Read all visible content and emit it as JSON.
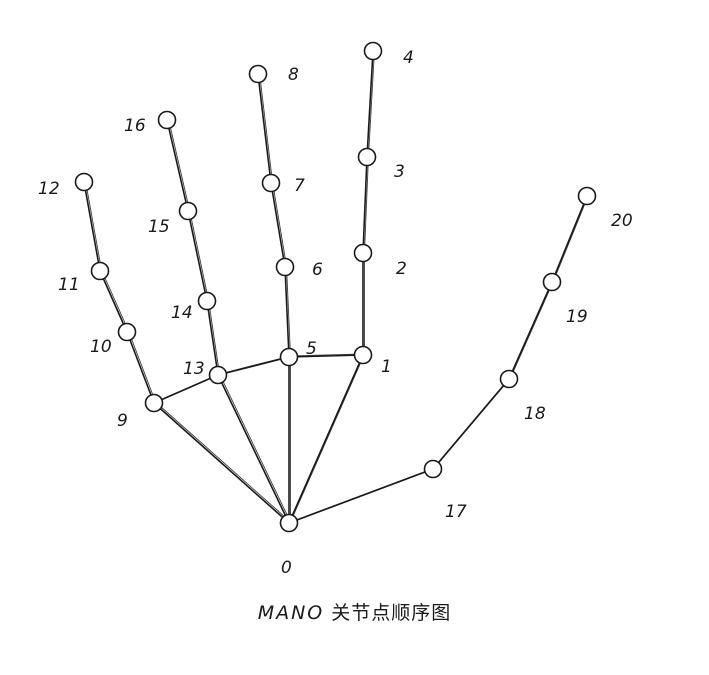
{
  "caption": {
    "latin": "MANO",
    "cjk": "关节点顺序图"
  },
  "joints": [
    {
      "id": 0,
      "label": "0"
    },
    {
      "id": 1,
      "label": "1"
    },
    {
      "id": 2,
      "label": "2"
    },
    {
      "id": 3,
      "label": "3"
    },
    {
      "id": 4,
      "label": "4"
    },
    {
      "id": 5,
      "label": "5"
    },
    {
      "id": 6,
      "label": "6"
    },
    {
      "id": 7,
      "label": "7"
    },
    {
      "id": 8,
      "label": "8"
    },
    {
      "id": 9,
      "label": "9"
    },
    {
      "id": 10,
      "label": "10"
    },
    {
      "id": 11,
      "label": "11"
    },
    {
      "id": 12,
      "label": "12"
    },
    {
      "id": 13,
      "label": "13"
    },
    {
      "id": 14,
      "label": "14"
    },
    {
      "id": 15,
      "label": "15"
    },
    {
      "id": 16,
      "label": "16"
    },
    {
      "id": 17,
      "label": "17"
    },
    {
      "id": 18,
      "label": "18"
    },
    {
      "id": 19,
      "label": "19"
    },
    {
      "id": 20,
      "label": "20"
    }
  ],
  "bones": [
    [
      0,
      1
    ],
    [
      1,
      2
    ],
    [
      2,
      3
    ],
    [
      3,
      4
    ],
    [
      0,
      5
    ],
    [
      5,
      6
    ],
    [
      6,
      7
    ],
    [
      7,
      8
    ],
    [
      0,
      9
    ],
    [
      9,
      10
    ],
    [
      10,
      11
    ],
    [
      11,
      12
    ],
    [
      0,
      13
    ],
    [
      13,
      14
    ],
    [
      14,
      15
    ],
    [
      15,
      16
    ],
    [
      0,
      17
    ],
    [
      17,
      18
    ],
    [
      18,
      19
    ],
    [
      19,
      20
    ],
    [
      9,
      13
    ],
    [
      13,
      5
    ],
    [
      5,
      1
    ]
  ]
}
